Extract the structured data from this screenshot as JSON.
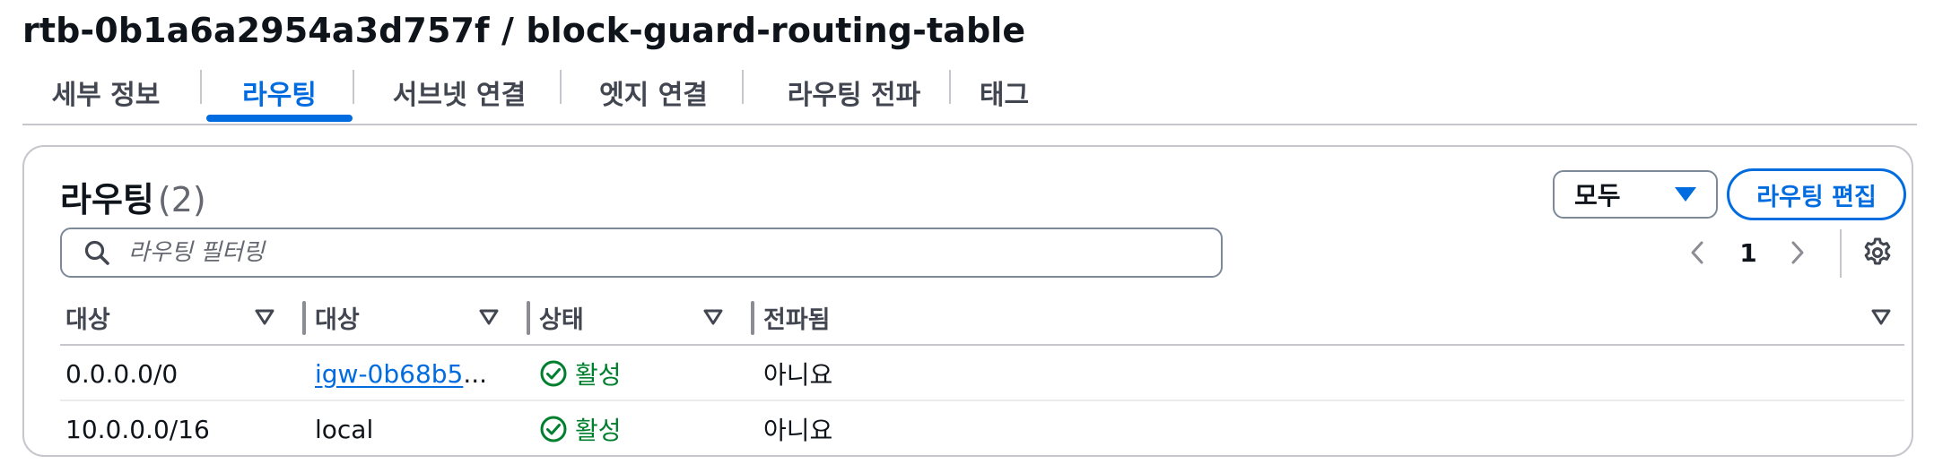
{
  "page": {
    "title": "rtb-0b1a6a2954a3d757f / block-guard-routing-table"
  },
  "tabs": [
    {
      "label": "세부 정보",
      "active": false
    },
    {
      "label": "라우팅",
      "active": true
    },
    {
      "label": "서브넷 연결",
      "active": false
    },
    {
      "label": "엣지 연결",
      "active": false
    },
    {
      "label": "라우팅 전파",
      "active": false
    },
    {
      "label": "태그",
      "active": false
    }
  ],
  "routes": {
    "title": "라우팅",
    "count": "(2)",
    "filter_select": "모두",
    "edit_button": "라우팅 편집",
    "search_placeholder": "라우팅 필터링",
    "page_number": "1",
    "columns": [
      "대상",
      "대상",
      "상태",
      "전파됨"
    ],
    "rows": [
      {
        "destination": "0.0.0.0/0",
        "target": "igw-0b68b5",
        "target_truncated": "...",
        "status": "활성",
        "propagated": "아니요"
      },
      {
        "destination": "10.0.0.0/16",
        "target": "local",
        "status": "활성",
        "propagated": "아니요"
      }
    ]
  },
  "colors": {
    "accent": "#006ce0",
    "status_success": "#00802f",
    "text": "#0f141a",
    "border": "#c6c6cd"
  },
  "icons": {
    "search": "search-icon",
    "dropdown": "caret-down-icon",
    "prev": "chevron-left-icon",
    "next": "chevron-right-icon",
    "settings": "gear-icon",
    "sort": "sort-caret-down-icon",
    "status": "check-circle-icon"
  }
}
